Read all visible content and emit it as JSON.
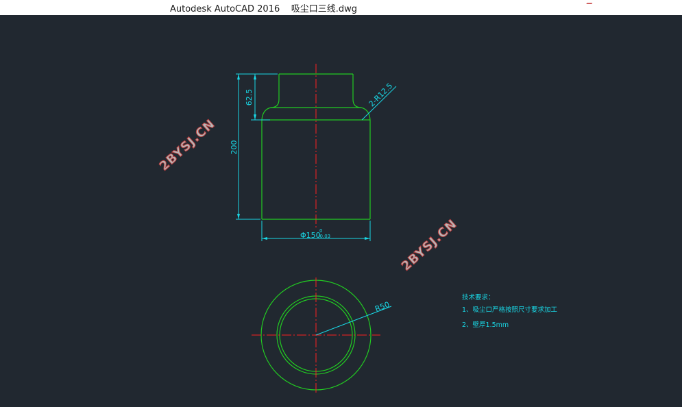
{
  "window": {
    "title": "Autodesk AutoCAD 2016    吸尘口三线.dwg"
  },
  "drawing": {
    "dimensions": {
      "neck_height": "62.5",
      "fillet": "2-R12.5",
      "total_height": "200",
      "diameter": "Φ150",
      "tol_upper": "0",
      "tol_lower": "-0.03",
      "radius": "R50"
    },
    "notes": {
      "heading": "技术要求：",
      "line1": "1、吸尘口严格按照尺寸要求加工",
      "line2": "2、壁厚1.5mm"
    },
    "watermarks": [
      "2BYSJ.CN",
      "2BYSJ.CN"
    ]
  },
  "colors": {
    "background": "#212830",
    "geometry": "#22cc22",
    "dimension": "#19d8e6",
    "centerline": "#ff2020"
  }
}
